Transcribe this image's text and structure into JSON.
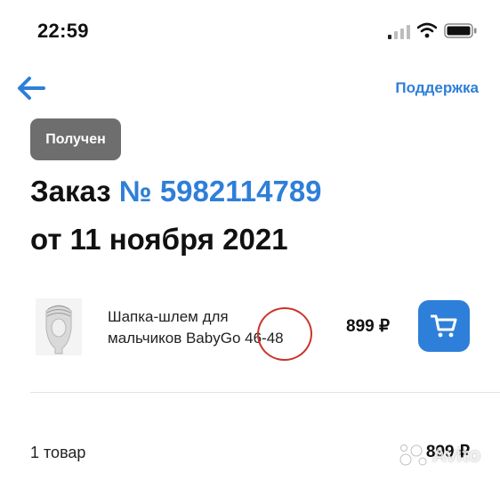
{
  "status_bar": {
    "time": "22:59",
    "battery_icon": "battery-icon",
    "wifi_icon": "wifi-icon",
    "signal_icon": "signal-icon"
  },
  "header": {
    "back_icon": "arrow-left-icon",
    "support_label": "Поддержка"
  },
  "order": {
    "status": "Получен",
    "title_prefix": "Заказ",
    "number": "№ 5982114789",
    "date": "от 11 ноября 2021"
  },
  "product": {
    "name": "Шапка-шлем для мальчиков BabyGo 46-48",
    "price": "899 ₽",
    "cart_icon": "cart-icon"
  },
  "summary": {
    "items_count": "1 товар",
    "total": "899 ₽"
  },
  "watermark": {
    "text": "Avito"
  },
  "colors": {
    "accent": "#2e7fd9",
    "badge_bg": "#6e6e6e",
    "annotation_red": "#c9352a"
  }
}
